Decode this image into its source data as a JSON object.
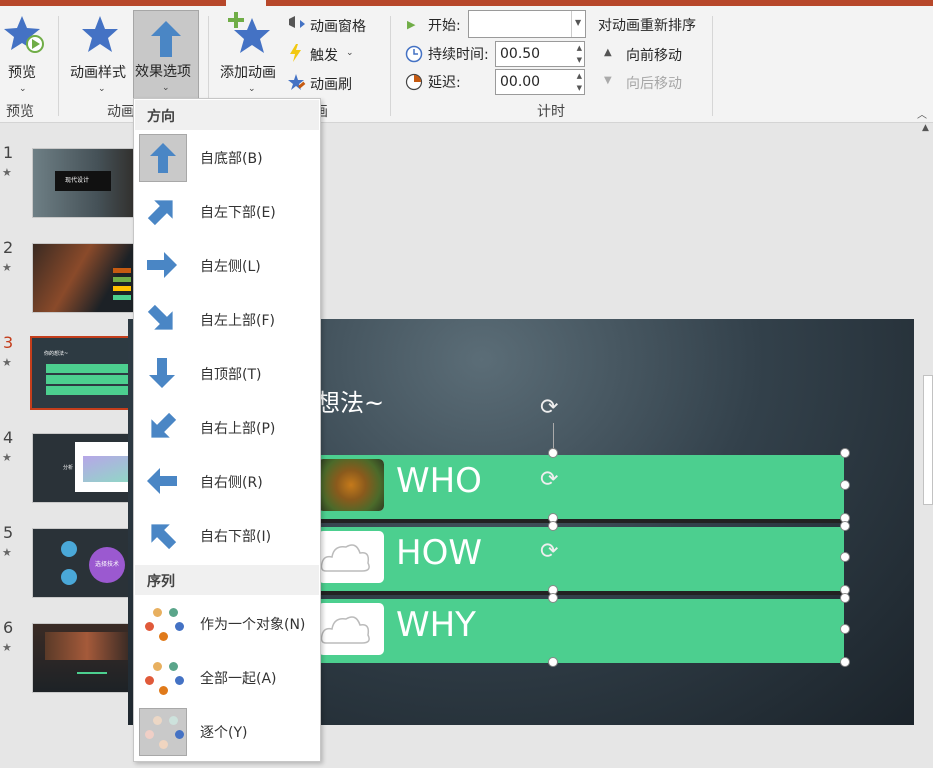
{
  "ribbon": {
    "preview_label": "预览",
    "group_preview": "预览",
    "anim_style_label": "动画样式",
    "effect_options_label": "效果选项",
    "group_animation": "动画",
    "add_anim_label": "添加动画",
    "anim_pane_label": "动画窗格",
    "trigger_label": "触发",
    "anim_brush_label": "动画刷",
    "group_adv_suffix": "画",
    "start_label": "开始:",
    "start_value": "",
    "duration_label": "持续时间:",
    "duration_value": "00.50",
    "delay_label": "延迟:",
    "delay_value": "00.00",
    "group_timing": "计时",
    "reorder_title": "对动画重新排序",
    "move_forward": "向前移动",
    "move_backward": "向后移动"
  },
  "slides": [
    {
      "num": "1",
      "thumb_text": "现代设计"
    },
    {
      "num": "2",
      "thumb_text": ""
    },
    {
      "num": "3",
      "thumb_text": "你的想法~"
    },
    {
      "num": "4",
      "thumb_text": "分析"
    },
    {
      "num": "5",
      "thumb_text": "选择技术"
    },
    {
      "num": "6",
      "thumb_text": ""
    }
  ],
  "slide": {
    "title": "想法~",
    "rows": [
      "WHO",
      "HOW",
      "WHY"
    ]
  },
  "dropdown": {
    "section_direction": "方向",
    "directions": [
      "自底部(B)",
      "自左下部(E)",
      "自左侧(L)",
      "自左上部(F)",
      "自顶部(T)",
      "自右上部(P)",
      "自右侧(R)",
      "自右下部(I)"
    ],
    "section_sequence": "序列",
    "sequences": [
      "作为一个对象(N)",
      "全部一起(A)",
      "逐个(Y)"
    ]
  },
  "colors": {
    "accent": "#b7472a",
    "arrow_blue": "#4a86c5",
    "slide_green": "#4ccf8f",
    "star_blue": "#4472c4"
  }
}
